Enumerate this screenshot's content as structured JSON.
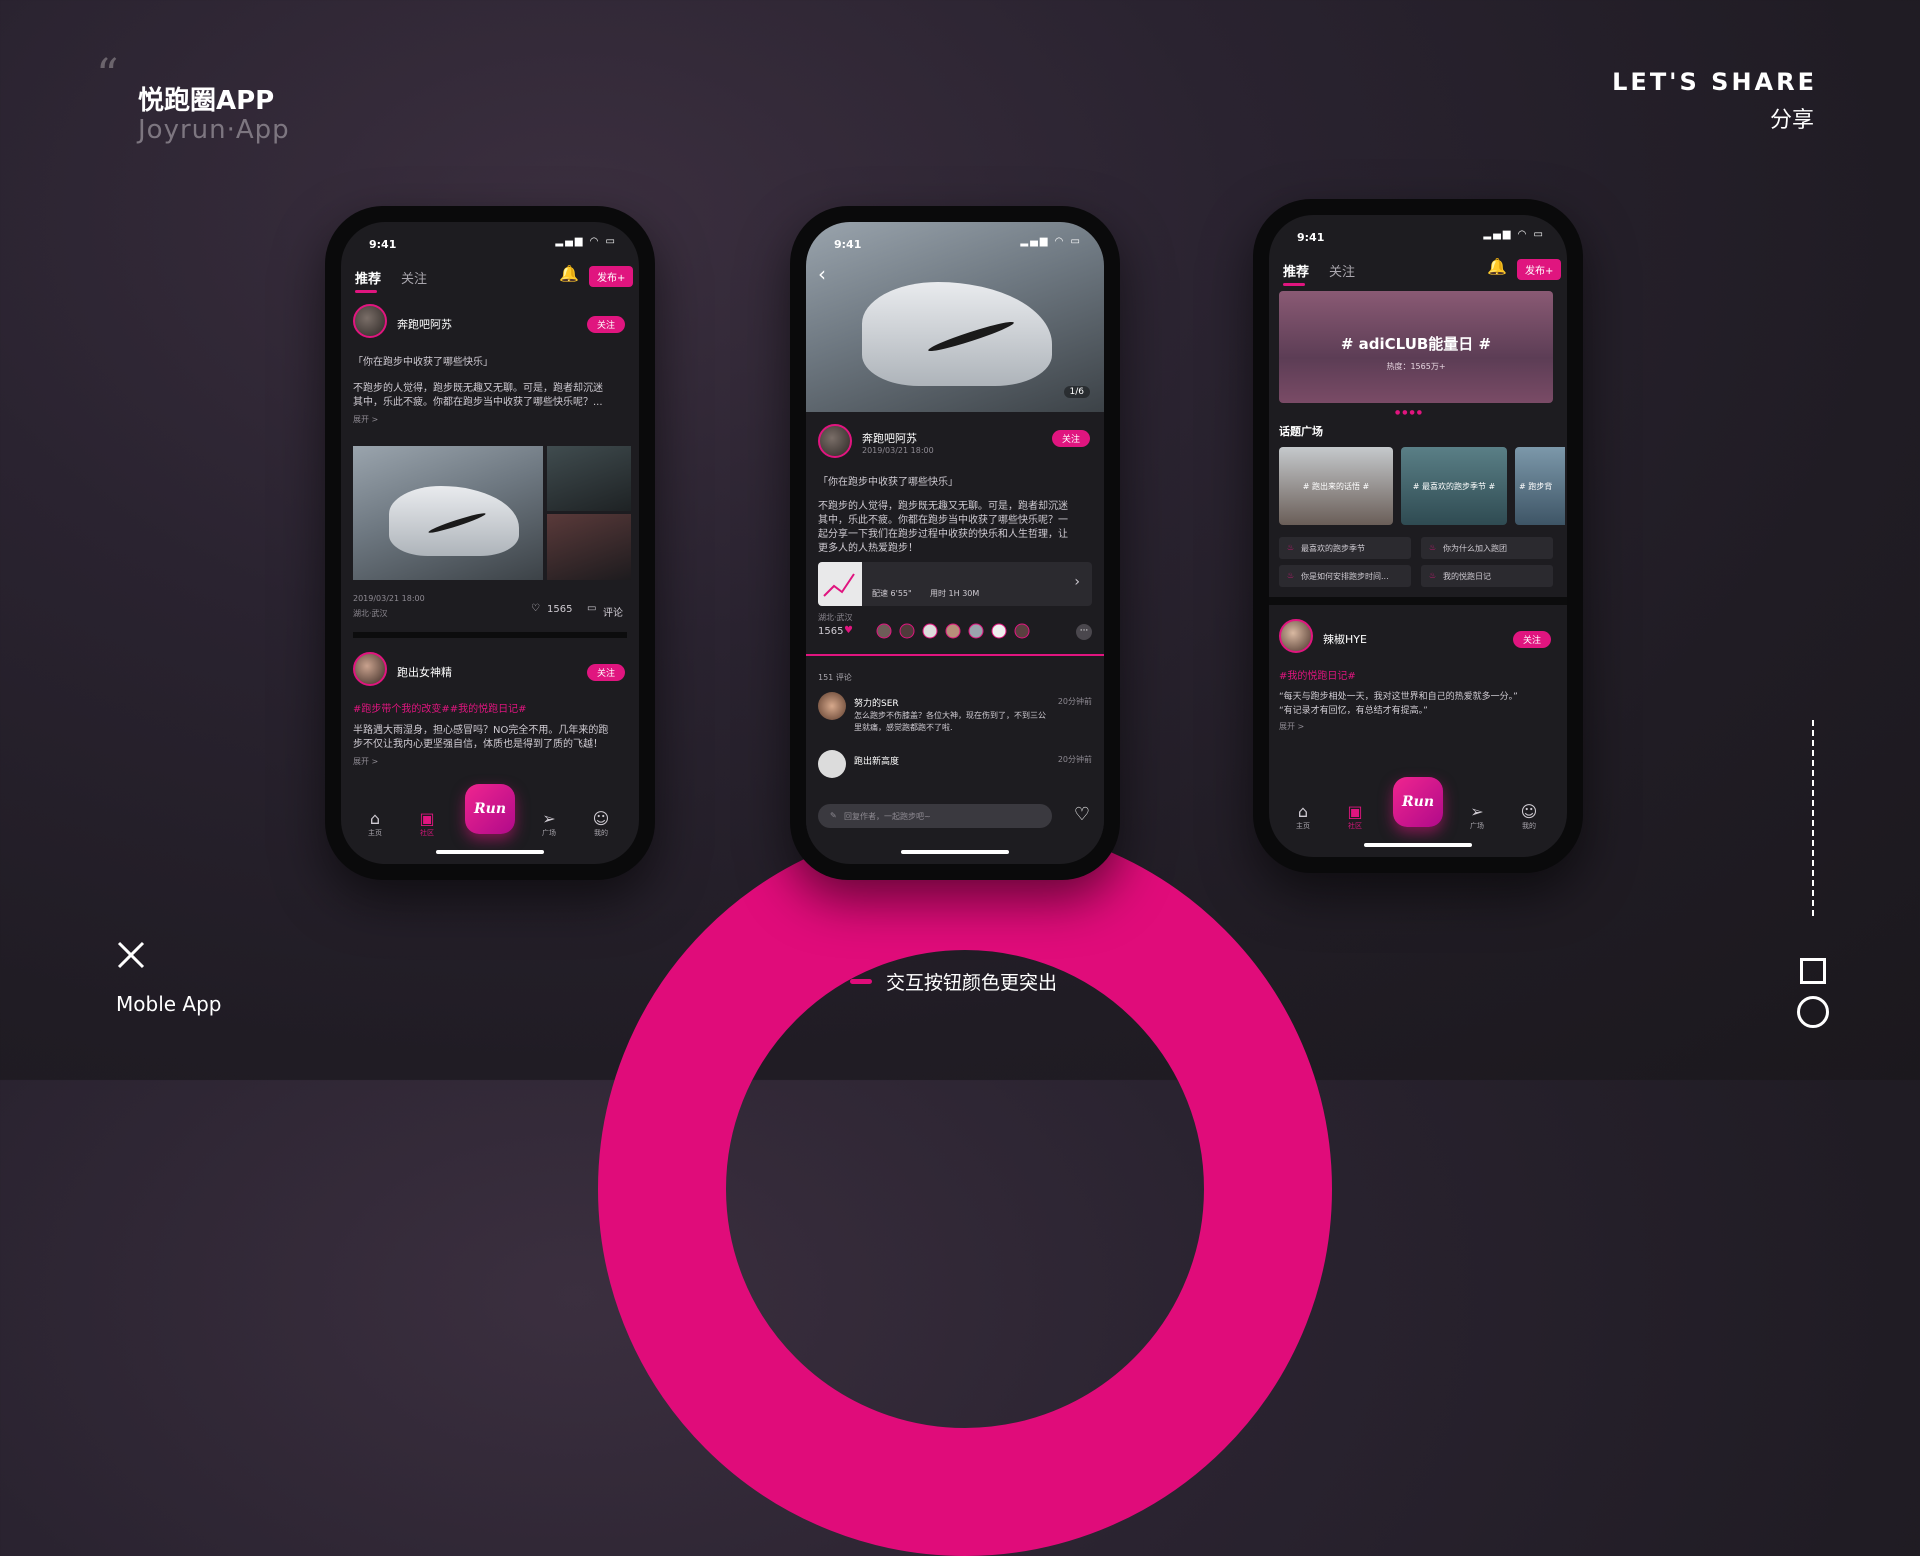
{
  "header": {
    "title_cn": "悦跑圈APP",
    "title_en": "Joyrun·App",
    "share_en": "LET'S SHARE",
    "share_cn": "分享"
  },
  "footer": {
    "brand_label": "Moble App",
    "caption": "交互按钮颜色更突出"
  },
  "colors": {
    "accent": "#e00c7a",
    "background": "#221d26"
  },
  "phone_left": {
    "time": "9:41",
    "tab_recommend": "推荐",
    "tab_follow": "关注",
    "publish": "发布+",
    "post1": {
      "user": "奔跑吧阿苏",
      "follow": "关注",
      "topic": "「你在跑步中收获了哪些快乐」",
      "body1": "不跑步的人觉得，跑步既无趣又无聊。可是，跑者却沉迷",
      "body2": "其中，乐此不疲。你都在跑步当中收获了哪些快乐呢？...",
      "expand": "展开 >",
      "date": "2019/03/21 18:00",
      "location": "湖北·武汉",
      "likes": "1565",
      "comment": "评论"
    },
    "post2": {
      "user": "跑出女神精",
      "follow": "关注",
      "tags": "#跑步带个我的改变##我的悦跑日记#",
      "body1": "半路遇大雨湿身，担心感冒吗？NO完全不用。几年来的跑",
      "body2": "步不仅让我内心更坚强自信，体质也是得到了质的飞越！",
      "expand": "展开 >"
    },
    "nav": [
      "主页",
      "社区",
      "Run",
      "广场",
      "我的"
    ]
  },
  "phone_center": {
    "time": "9:41",
    "pager": "1/6",
    "user": "奔跑吧阿苏",
    "date": "2019/03/21 18:00",
    "follow": "关注",
    "topic": "「你在跑步中收获了哪些快乐」",
    "body1": "不跑步的人觉得，跑步既无趣又无聊。可是，跑者却沉迷",
    "body2": "其中，乐此不疲。你都在跑步当中收获了哪些快乐呢？一",
    "body3": "起分享一下我们在跑步过程中收获的快乐和人生哲理，让",
    "body4": "更多人的人热爱跑步！",
    "pace": "配速 6'55\"",
    "duration": "用时 1H 30M",
    "location": "湖北·武汉",
    "likes": "1565",
    "comments_count": "151 评论",
    "comment1": {
      "user": "努力的SER",
      "time": "20分钟前",
      "text1": "怎么跑步不伤膝盖？各位大神，现在伤到了，不到三公",
      "text2": "里就痛，感觉跑都跑不了啦."
    },
    "comment2": {
      "user": "跑出新高度",
      "time": "20分钟前"
    },
    "reply_placeholder": "回复作者，一起跑步吧~"
  },
  "phone_right": {
    "time": "9:41",
    "tab_recommend": "推荐",
    "tab_follow": "关注",
    "publish": "发布+",
    "banner_title": "# adiCLUB能量日 #",
    "banner_sub": "热度：1565万+",
    "section_title": "话题广场",
    "cards": [
      "# 跑出来的话悟 #",
      "# 最喜欢的跑步季节 #",
      "# 跑步背"
    ],
    "topics": [
      "最喜欢的跑步季节",
      "你为什么加入跑团",
      "你是如何安排跑步时间...",
      "我的悦跑日记"
    ],
    "post": {
      "user": "辣椒HYE",
      "follow": "关注",
      "tag": "#我的悦跑日记#",
      "body1": "“每天与跑步相处一天，我对这世界和自己的热爱就多一分。”",
      "body2": "“有记录才有回忆，有总结才有提高。”",
      "expand": "展开 >"
    },
    "nav": [
      "主页",
      "社区",
      "Run",
      "广场",
      "我的"
    ]
  }
}
